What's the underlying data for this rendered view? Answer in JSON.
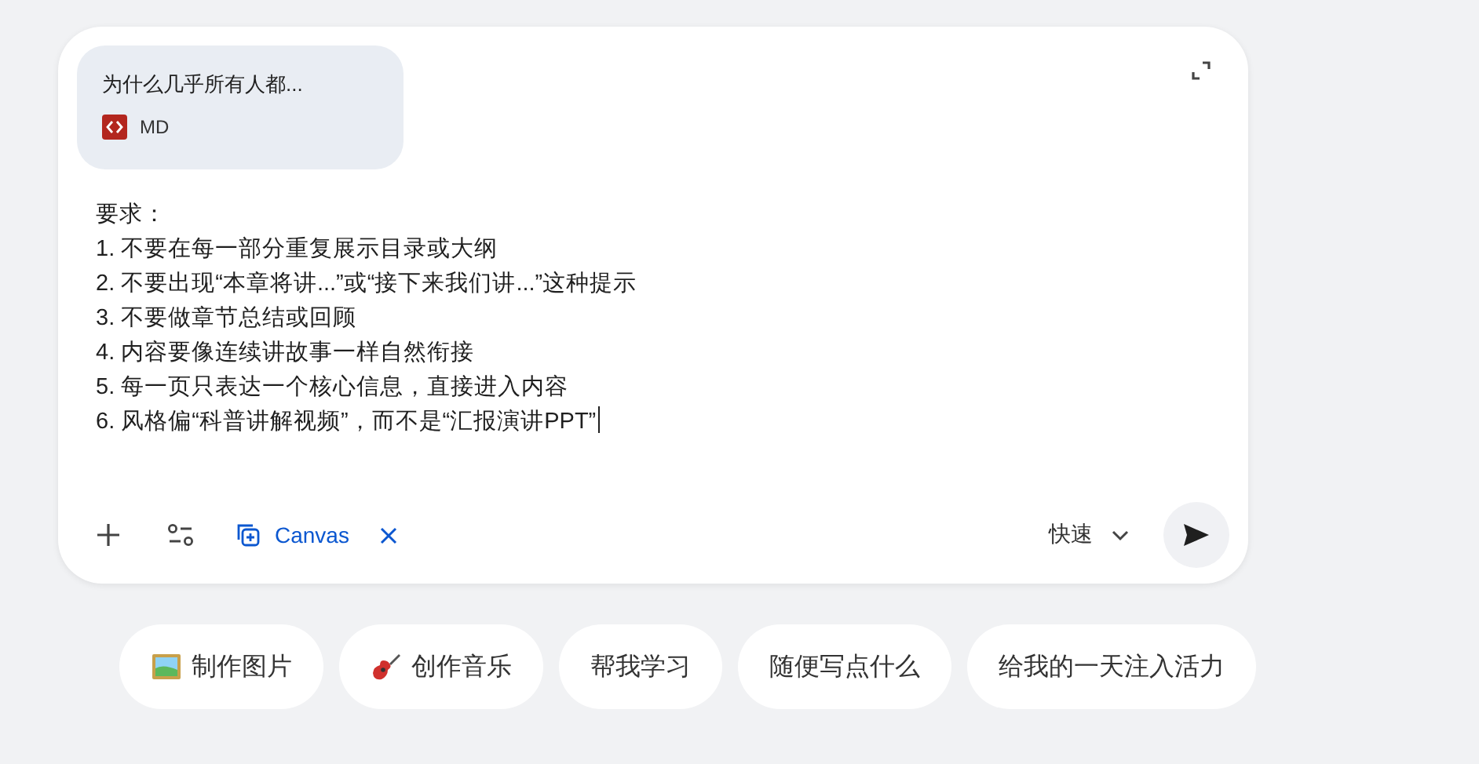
{
  "attachment": {
    "title": "为什么几乎所有人都...",
    "file_type": "MD"
  },
  "prompt": {
    "lines": [
      "要求：",
      "1. 不要在每一部分重复展示目录或大纲",
      "2. 不要出现“本章将讲...”或“接下来我们讲...”这种提示",
      "3. 不要做章节总结或回顾",
      "4. 内容要像连续讲故事一样自然衔接",
      "5. 每一页只表达一个核心信息，直接进入内容",
      "6. 风格偏“科普讲解视频”，而不是“汇报演讲PPT”"
    ]
  },
  "toolbar": {
    "tool": {
      "label": "Canvas"
    },
    "mode": "快速"
  },
  "suggestions": [
    {
      "label": "制作图片",
      "kind": "image"
    },
    {
      "label": "创作音乐",
      "kind": "music"
    },
    {
      "label": "帮我学习",
      "kind": "plain"
    },
    {
      "label": "随便写点什么",
      "kind": "plain"
    },
    {
      "label": "给我的一天注入活力",
      "kind": "plain"
    }
  ]
}
